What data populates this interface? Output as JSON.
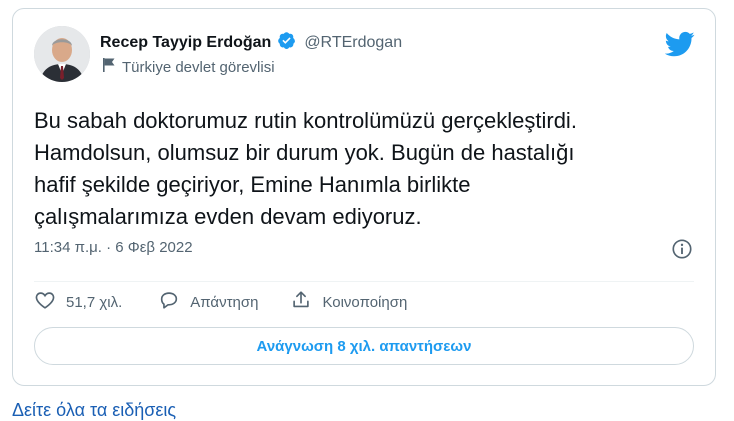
{
  "tweet": {
    "author_name": "Recep Tayyip Erdoğan",
    "handle": "@RTErdogan",
    "label": "Türkiye devlet görevlisi",
    "text_lines": [
      "Bu sabah doktorumuz rutin kontrolümüzü gerçekleştirdi.",
      "Hamdolsun, olumsuz bir durum yok. Bugün de hastalığı",
      "hafif şekilde geçiriyor, Emine Hanımla birlikte",
      "çalışmalarımıza evden devam ediyoruz."
    ],
    "timestamp": "11:34 π.μ. · 6 Φεβ 2022",
    "likes": "51,7 χιλ.",
    "reply_label": "Απάντηση",
    "share_label": "Κοινοποίηση",
    "read_replies_label": "Ανάγνωση 8 χιλ. απαντήσεων"
  },
  "footer": {
    "more_link": "Δείτε όλα τα ειδήσεις"
  },
  "icons": {
    "bird": "twitter-bird-icon",
    "verified": "verified-badge-icon",
    "flag": "flag-icon",
    "info": "info-icon",
    "like": "heart-icon",
    "reply": "reply-bubble-icon",
    "share": "share-icon"
  },
  "colors": {
    "brand_blue": "#1d9bf0",
    "secondary_text": "#536471",
    "border": "#cfd9de"
  }
}
